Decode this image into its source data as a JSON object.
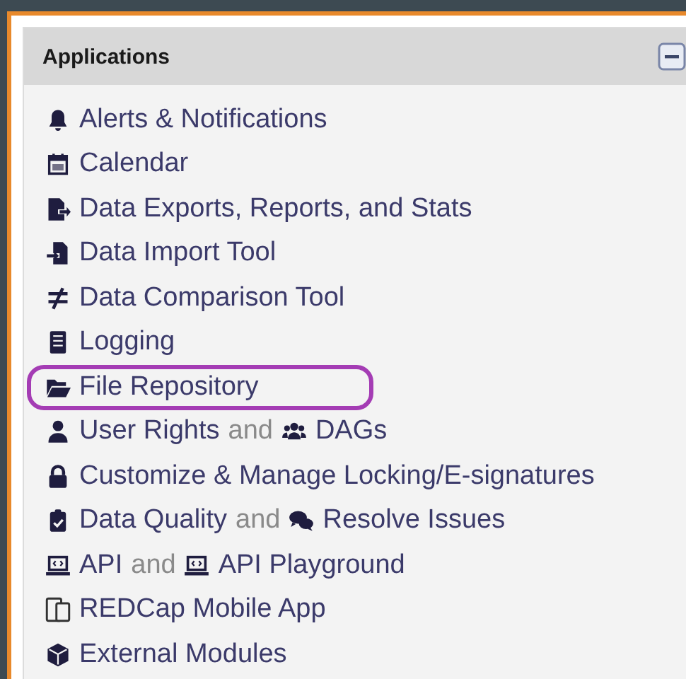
{
  "panel": {
    "title": "Applications"
  },
  "items": [
    {
      "highlighted": false,
      "parts": [
        {
          "kind": "link",
          "text": "Alerts & Notifications"
        }
      ]
    },
    {
      "highlighted": false,
      "parts": [
        {
          "kind": "link",
          "text": "Calendar"
        }
      ]
    },
    {
      "highlighted": false,
      "parts": [
        {
          "kind": "link",
          "text": "Data Exports, Reports, and Stats"
        }
      ]
    },
    {
      "highlighted": false,
      "parts": [
        {
          "kind": "link",
          "text": "Data Import Tool"
        }
      ]
    },
    {
      "highlighted": false,
      "parts": [
        {
          "kind": "link",
          "text": "Data Comparison Tool"
        }
      ]
    },
    {
      "highlighted": false,
      "parts": [
        {
          "kind": "link",
          "text": "Logging"
        }
      ]
    },
    {
      "highlighted": true,
      "parts": [
        {
          "kind": "link",
          "text": "File Repository"
        }
      ]
    },
    {
      "highlighted": false,
      "parts": [
        {
          "kind": "link",
          "text": "User Rights"
        },
        {
          "kind": "joiner",
          "text": "and"
        },
        {
          "kind": "link",
          "text": "DAGs"
        }
      ]
    },
    {
      "highlighted": false,
      "parts": [
        {
          "kind": "link",
          "text": "Customize & Manage Locking/E-signatures"
        }
      ]
    },
    {
      "highlighted": false,
      "parts": [
        {
          "kind": "link",
          "text": "Data Quality"
        },
        {
          "kind": "joiner",
          "text": "and"
        },
        {
          "kind": "link",
          "text": "Resolve Issues"
        }
      ]
    },
    {
      "highlighted": false,
      "parts": [
        {
          "kind": "link",
          "text": "API"
        },
        {
          "kind": "joiner",
          "text": "and"
        },
        {
          "kind": "link",
          "text": "API Playground"
        }
      ]
    },
    {
      "highlighted": false,
      "parts": [
        {
          "kind": "link",
          "text": "REDCap Mobile App"
        }
      ]
    },
    {
      "highlighted": false,
      "parts": [
        {
          "kind": "link",
          "text": "External Modules"
        }
      ]
    }
  ]
}
